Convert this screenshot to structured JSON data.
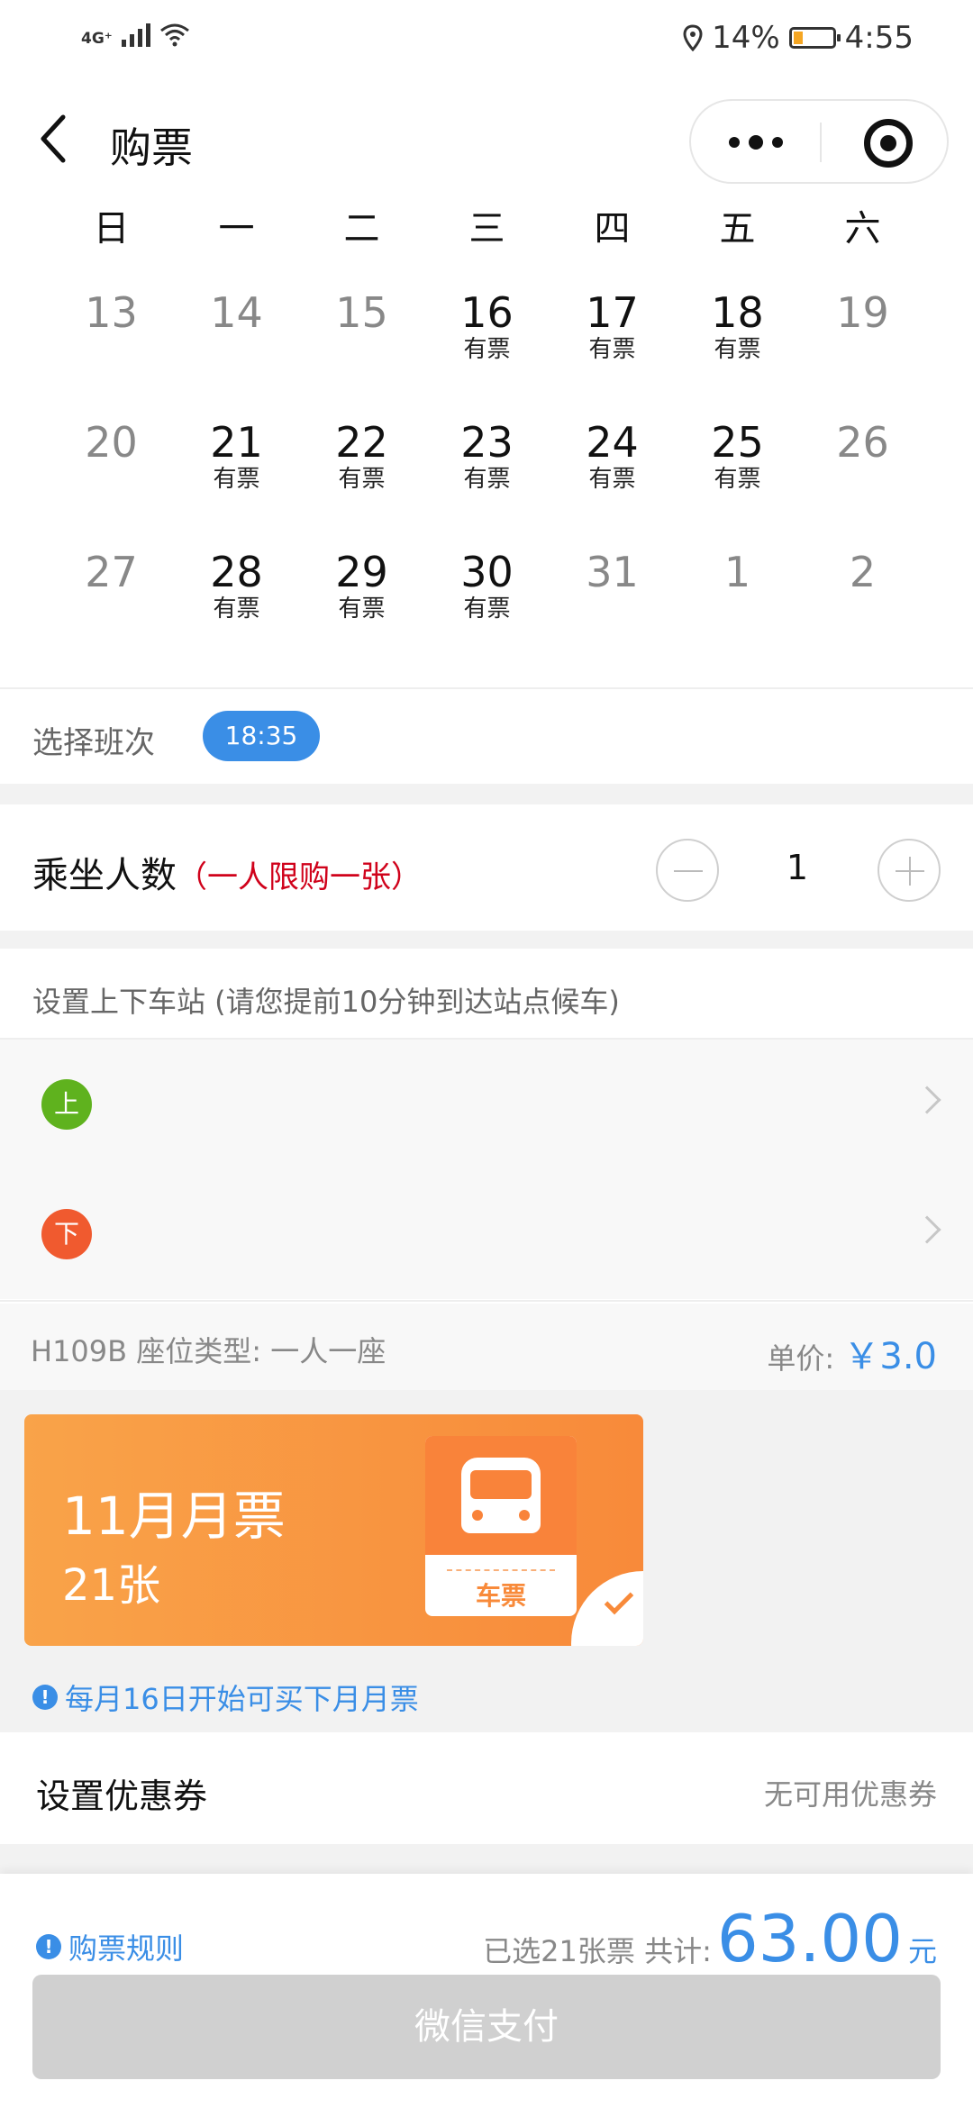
{
  "status_bar": {
    "network": "4G⁺",
    "battery": "14%",
    "time": "4:55"
  },
  "header": {
    "title": "购票"
  },
  "calendar": {
    "weekdays": [
      "日",
      "一",
      "二",
      "三",
      "四",
      "五",
      "六"
    ],
    "weeks": [
      [
        {
          "day": "13",
          "tag": ""
        },
        {
          "day": "14",
          "tag": ""
        },
        {
          "day": "15",
          "tag": ""
        },
        {
          "day": "16",
          "tag": "有票"
        },
        {
          "day": "17",
          "tag": "有票"
        },
        {
          "day": "18",
          "tag": "有票"
        },
        {
          "day": "19",
          "tag": ""
        }
      ],
      [
        {
          "day": "20",
          "tag": ""
        },
        {
          "day": "21",
          "tag": "有票"
        },
        {
          "day": "22",
          "tag": "有票"
        },
        {
          "day": "23",
          "tag": "有票"
        },
        {
          "day": "24",
          "tag": "有票"
        },
        {
          "day": "25",
          "tag": "有票"
        },
        {
          "day": "26",
          "tag": ""
        }
      ],
      [
        {
          "day": "27",
          "tag": ""
        },
        {
          "day": "28",
          "tag": "有票"
        },
        {
          "day": "29",
          "tag": "有票"
        },
        {
          "day": "30",
          "tag": "有票"
        },
        {
          "day": "31",
          "tag": ""
        },
        {
          "day": "1",
          "tag": ""
        },
        {
          "day": "2",
          "tag": ""
        }
      ]
    ]
  },
  "schedule": {
    "label": "选择班次",
    "selected": "18:35"
  },
  "passengers": {
    "label": "乘坐人数",
    "note": "（一人限购一张）",
    "quantity": "1"
  },
  "stations": {
    "header": "设置上下车站 (请您提前10分钟到达站点候车)",
    "board_badge": "上",
    "alight_badge": "下",
    "board_color": "#5fb21e",
    "alight_color": "#f05a2f"
  },
  "seat": {
    "info": "H109B 座位类型: 一人一座",
    "price_label": "单价:",
    "price": "￥3.0"
  },
  "monthly_ticket": {
    "title": "11月月票",
    "count": "21张",
    "icon_label": "车票",
    "note": "每月16日开始可买下月月票"
  },
  "coupon": {
    "label": "设置优惠券",
    "value": "无可用优惠券"
  },
  "footer": {
    "rules": "购票规则",
    "summary": "已选21张票 共计:",
    "amount": "63.00",
    "unit": "元",
    "pay_button": "微信支付"
  },
  "colors": {
    "accent": "#3a8ee6",
    "warning": "#d0021b",
    "ticket_orange": "#f88a3a"
  }
}
